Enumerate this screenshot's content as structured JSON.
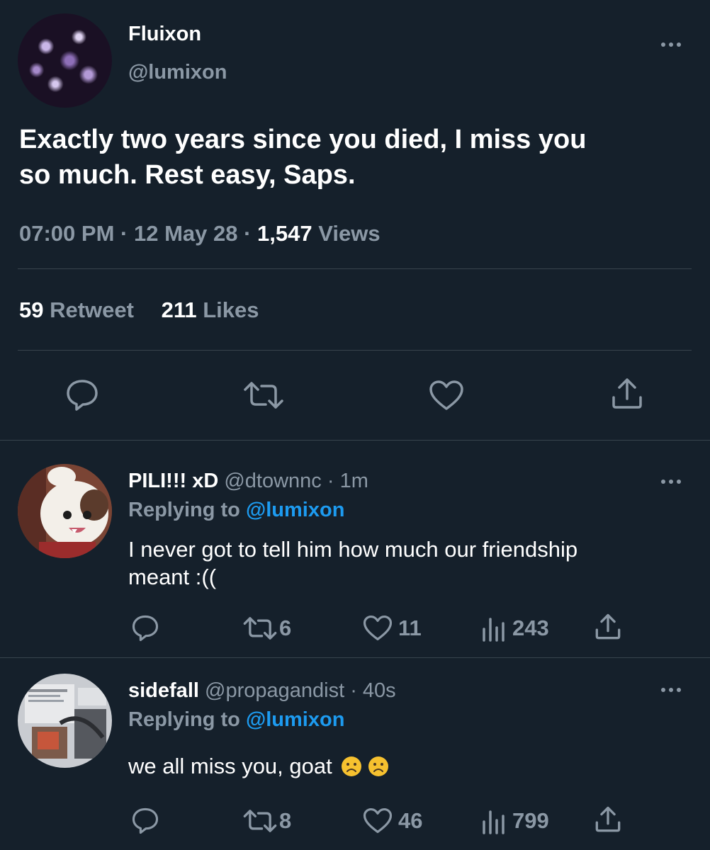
{
  "main_tweet": {
    "display_name": "Fluixon",
    "handle": "@lumixon",
    "text_line1": "Exactly two years since you died, I miss you",
    "text_line2": "so much. Rest easy, Saps.",
    "time": "07:00 PM",
    "date": "12 May 28",
    "views_count": "1,547",
    "views_label": "Views",
    "retweets_count": "59",
    "retweets_label": "Retweet",
    "likes_count": "211",
    "likes_label": "Likes"
  },
  "replies": [
    {
      "display_name": "PILI!!! xD",
      "handle": "@dtownnc",
      "time": "1m",
      "replying_label": "Replying to",
      "replying_handle": "@lumixon",
      "text_line1": "I never got to tell him how much our friendship",
      "text_line2": "meant :((",
      "retweets": "6",
      "likes": "11",
      "views": "243"
    },
    {
      "display_name": "sidefall",
      "handle": "@propagandist",
      "time": "40s",
      "replying_label": "Replying to",
      "replying_handle": "@lumixon",
      "text": "we all miss you, goat",
      "emojis": [
        "frowning-face",
        "frowning-face"
      ],
      "retweets": "8",
      "likes": "46",
      "views": "799"
    }
  ],
  "colors": {
    "background": "#15202b",
    "muted": "#8b98a5",
    "link": "#1d9bf0",
    "divider": "#38444d"
  }
}
